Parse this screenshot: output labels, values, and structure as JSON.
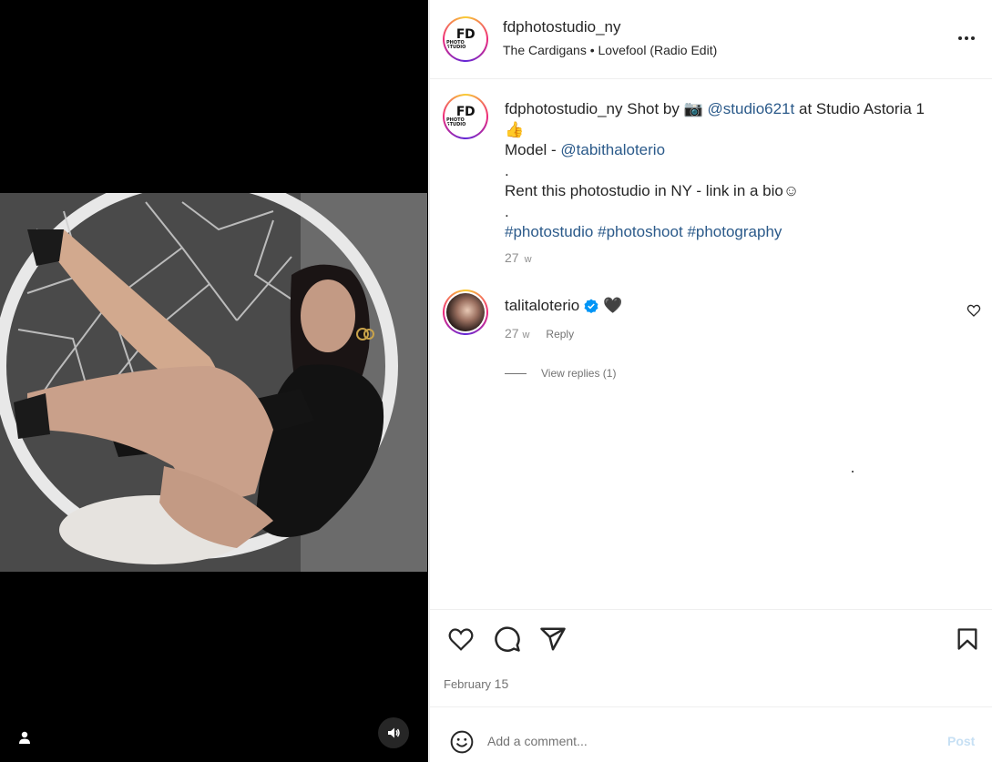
{
  "header": {
    "username": "fdphotostudio_ny",
    "music": "The Cardigans • Lovefool (Radio Edit)",
    "avatar_logo": "FD",
    "avatar_logo_sub": "PHOTO STUDIO"
  },
  "caption": {
    "username": "fdphotostudio_ny",
    "text_shot_by": "Shot by",
    "camera_emoji": "📷",
    "mention_photographer": "@studio621t",
    "text_at": "at Studio Astoria 1",
    "thumbs_emoji": "👍",
    "model_label": "Model -",
    "mention_model": "@tabithaloterio",
    "separator": ".",
    "rent_text": "Rent this photostudio in NY - link in a bio☺",
    "hashtags": [
      "#photostudio",
      "#photoshoot",
      "#photography"
    ],
    "age_number": "27",
    "age_unit": "w"
  },
  "comment": {
    "username": "talitaloterio",
    "text": "🖤",
    "age_number": "27",
    "age_unit": "w",
    "reply_label": "Reply",
    "view_replies": "View replies (1)"
  },
  "actions": {
    "date_month": "February",
    "date_day": "15"
  },
  "add_comment": {
    "placeholder": "Add a comment...",
    "post_label": "Post"
  },
  "colors": {
    "link": "#2b5a8a",
    "muted": "#737373",
    "verified": "#0095f6",
    "post_disabled": "#c7e0f4"
  },
  "icons": [
    "user-tag-icon",
    "volume-icon",
    "more-icon",
    "verified-badge-icon",
    "heart-icon",
    "comment-icon",
    "share-icon",
    "bookmark-icon",
    "emoji-icon"
  ]
}
